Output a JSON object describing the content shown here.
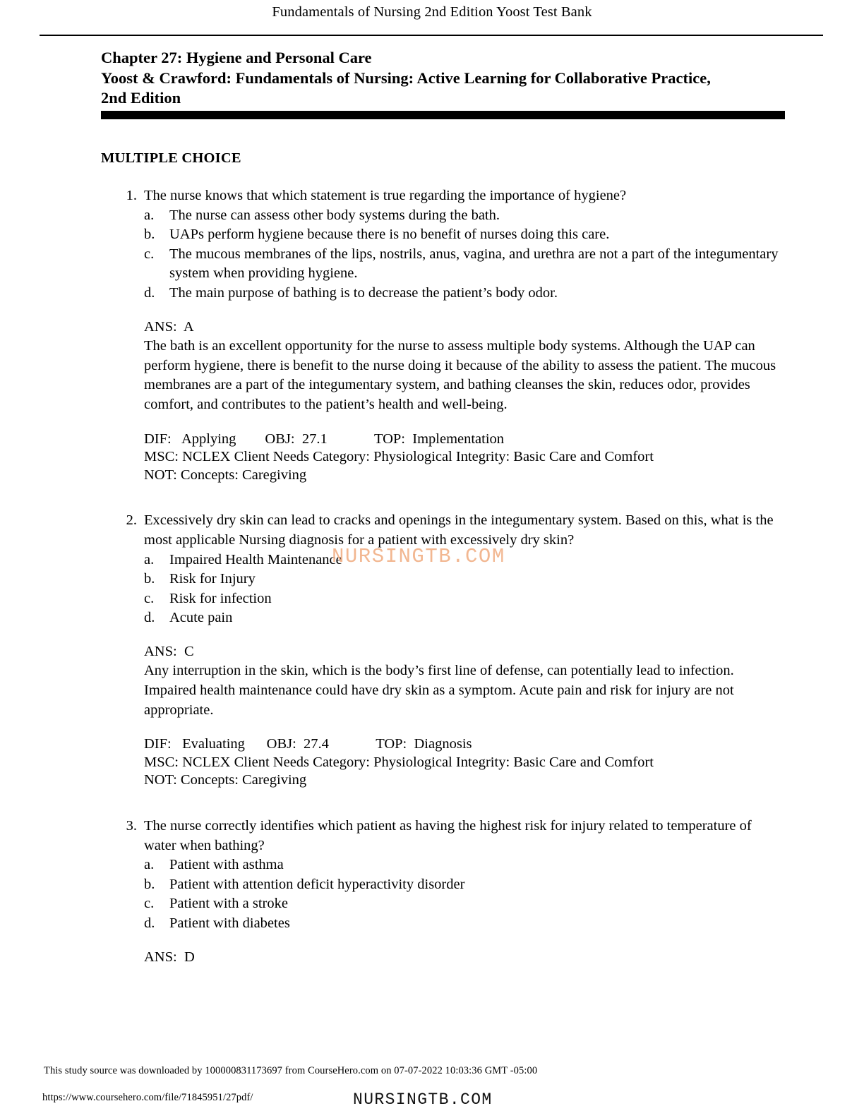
{
  "header": {
    "running_title": "Fundamentals of Nursing 2nd Edition Yoost Test Bank",
    "title_line1": "Chapter 27: Hygiene and Personal Care",
    "title_line2": "Yoost & Crawford: Fundamentals of Nursing: Active Learning for Collaborative Practice, 2nd Edition"
  },
  "section_heading": "MULTIPLE CHOICE",
  "questions": [
    {
      "number": "1.",
      "stem": "The nurse knows that which statement is true regarding the importance of hygiene?",
      "options": [
        {
          "letter": "a.",
          "text": "The nurse can assess other body systems during the bath."
        },
        {
          "letter": "b.",
          "text": "UAPs perform hygiene because there is no benefit of nurses doing this care."
        },
        {
          "letter": "c.",
          "text": "The mucous membranes of the lips, nostrils, anus, vagina, and urethra are not a part of the integumentary system when providing hygiene."
        },
        {
          "letter": "d.",
          "text": "The main purpose of bathing is to decrease the patient’s body odor."
        }
      ],
      "ans_label": "ANS:  A",
      "rationale": "The bath is an excellent opportunity for the nurse to assess multiple body systems. Although the UAP can perform hygiene, there is benefit to the nurse doing it because of the ability to assess the patient. The mucous membranes are a part of the integumentary system, and bathing cleanses the skin, reduces odor, provides comfort, and contributes to the patient’s health and well-being.",
      "dif_line": "DIF:   Applying        OBJ:  27.1             TOP:  Implementation",
      "msc_line": "MSC:  NCLEX Client Needs Category: Physiological Integrity: Basic Care and Comfort",
      "not_line": "NOT:  Concepts: Caregiving"
    },
    {
      "number": "2.",
      "stem": "Excessively dry skin can lead to cracks and openings in the integumentary system. Based on this, what is the most applicable Nursing diagnosis for a patient with excessively dry skin?",
      "options": [
        {
          "letter": "a.",
          "text": "Impaired Health Maintenance"
        },
        {
          "letter": "b.",
          "text": "Risk for Injury"
        },
        {
          "letter": "c.",
          "text": "Risk for infection"
        },
        {
          "letter": "d.",
          "text": "Acute pain"
        }
      ],
      "ans_label": "ANS:  C",
      "rationale": "Any interruption in the skin, which is the body’s first line of defense, can potentially lead to infection. Impaired health maintenance could have dry skin as a symptom. Acute pain and risk for injury are not appropriate.",
      "dif_line": "DIF:   Evaluating      OBJ:  27.4             TOP:  Diagnosis",
      "msc_line": "MSC:  NCLEX Client Needs Category: Physiological Integrity: Basic Care and Comfort",
      "not_line": "NOT:  Concepts: Caregiving"
    },
    {
      "number": "3.",
      "stem": "The nurse correctly identifies which patient as having the highest risk for injury related to temperature of water when bathing?",
      "options": [
        {
          "letter": "a.",
          "text": "Patient with asthma"
        },
        {
          "letter": "b.",
          "text": "Patient with attention deficit hyperactivity disorder"
        },
        {
          "letter": "c.",
          "text": "Patient with a stroke"
        },
        {
          "letter": "d.",
          "text": "Patient with diabetes"
        }
      ],
      "ans_label": "ANS:  D",
      "rationale": "",
      "dif_line": "",
      "msc_line": "",
      "not_line": ""
    }
  ],
  "watermarks": {
    "middle": "NURSINGTB.COM",
    "bottom": "NURSINGTB.COM",
    "middle_color": "#f2b48c"
  },
  "footer": {
    "download_note": "This study source was downloaded by 100000831173697 from CourseHero.com on 07-07-2022 10:03:36 GMT -05:00",
    "url": "https://www.coursehero.com/file/71845951/27pdf/"
  }
}
